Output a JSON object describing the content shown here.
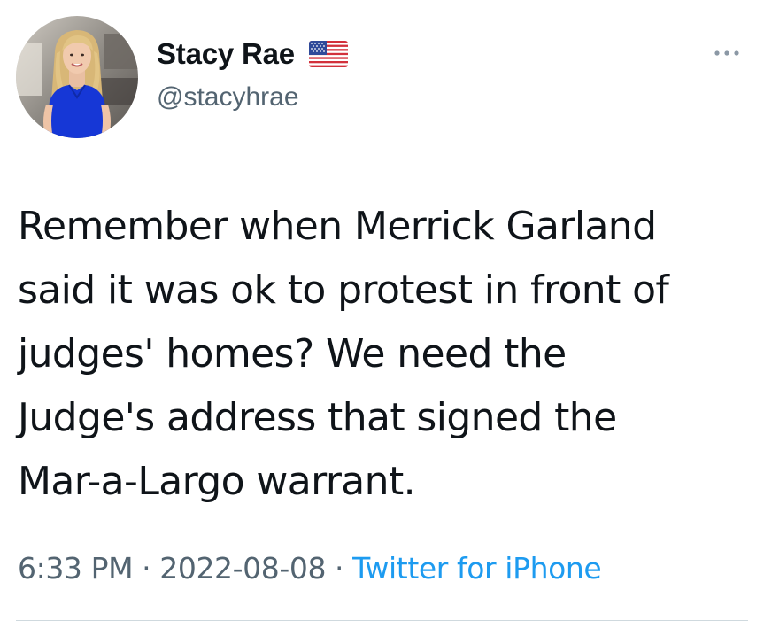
{
  "author": {
    "display_name": "Stacy Rae",
    "handle": "@stacyhrae",
    "badge_icon": "us-flag-icon"
  },
  "tweet": {
    "text_lines": [
      "Remember when Merrick Garland",
      "said it was ok to protest in front of",
      "judges' homes? We need the",
      "Judge's address that signed the",
      "Mar-a-Largo warrant."
    ],
    "time": "6:33 PM",
    "date": "2022-08-08",
    "separator": "·",
    "source": "Twitter for iPhone"
  },
  "colors": {
    "text_primary": "#0f1419",
    "text_secondary": "#536471",
    "link": "#1d9bf0",
    "divider": "#cfd9de"
  }
}
